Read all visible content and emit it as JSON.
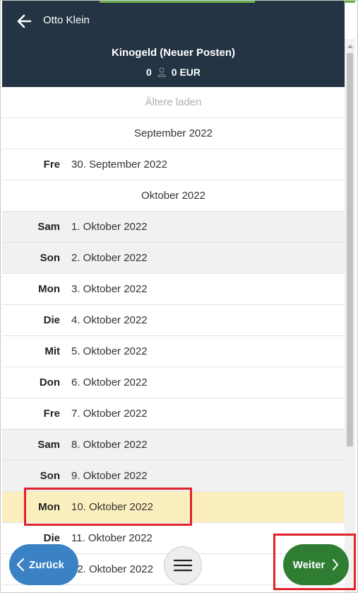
{
  "header": {
    "user_name": "Otto Klein",
    "title": "Kinogeld (Neuer Posten)",
    "count": "0",
    "amount": "0 EUR"
  },
  "list": {
    "load_older": "Ältere laden",
    "rows": [
      {
        "type": "month",
        "label": "September 2022"
      },
      {
        "type": "day",
        "day": "Fre",
        "date": "30. September 2022"
      },
      {
        "type": "month",
        "label": "Oktober 2022"
      },
      {
        "type": "day",
        "day": "Sam",
        "date": "1. Oktober 2022",
        "weekend": true
      },
      {
        "type": "day",
        "day": "Son",
        "date": "2. Oktober 2022",
        "weekend": true
      },
      {
        "type": "day",
        "day": "Mon",
        "date": "3. Oktober 2022"
      },
      {
        "type": "day",
        "day": "Die",
        "date": "4. Oktober 2022"
      },
      {
        "type": "day",
        "day": "Mit",
        "date": "5. Oktober 2022"
      },
      {
        "type": "day",
        "day": "Don",
        "date": "6. Oktober 2022"
      },
      {
        "type": "day",
        "day": "Fre",
        "date": "7. Oktober 2022"
      },
      {
        "type": "day",
        "day": "Sam",
        "date": "8. Oktober 2022",
        "weekend": true
      },
      {
        "type": "day",
        "day": "Son",
        "date": "9. Oktober 2022",
        "weekend": true
      },
      {
        "type": "day",
        "day": "Mon",
        "date": "10. Oktober 2022",
        "selected": true
      },
      {
        "type": "day",
        "day": "Die",
        "date": "11. Oktober 2022"
      },
      {
        "type": "day",
        "day": "Mit",
        "date": "12. Oktober 2022"
      }
    ]
  },
  "buttons": {
    "back_label": "Zurück",
    "next_label": "Weiter"
  },
  "colors": {
    "header_bg": "#253444",
    "highlight": "#fcefbf",
    "back_button": "#3b82c4",
    "next_button": "#2e7d32",
    "annotation": "#e2222c"
  }
}
